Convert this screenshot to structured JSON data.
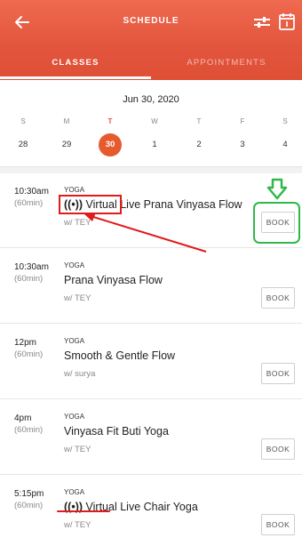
{
  "header": {
    "title": "SCHEDULE",
    "tabs": [
      {
        "label": "CLASSES",
        "active": true
      },
      {
        "label": "APPOINTMENTS",
        "active": false
      }
    ],
    "icons": {
      "back": "arrow-left-icon",
      "filter": "filter-sliders-icon",
      "calendar": "calendar-icon"
    }
  },
  "calendar": {
    "heading": "Jun 30, 2020",
    "days": [
      {
        "dow": "S",
        "dom": "28"
      },
      {
        "dow": "M",
        "dom": "29"
      },
      {
        "dow": "T",
        "dom": "30",
        "selected": true
      },
      {
        "dow": "W",
        "dom": "1"
      },
      {
        "dow": "T",
        "dom": "2"
      },
      {
        "dow": "F",
        "dom": "3"
      },
      {
        "dow": "S",
        "dom": "4"
      }
    ]
  },
  "classes": [
    {
      "time": "10:30am",
      "duration": "(60min)",
      "category": "YOGA",
      "virtual_mark": "((•))",
      "virtual_label": "Virtual",
      "name": "Live Prana Vinyasa Flow",
      "instructor": "w/ TEY",
      "book": "BOOK"
    },
    {
      "time": "10:30am",
      "duration": "(60min)",
      "category": "YOGA",
      "virtual_mark": "",
      "virtual_label": "",
      "name": "Prana Vinyasa Flow",
      "instructor": "w/ TEY",
      "book": "BOOK"
    },
    {
      "time": "12pm",
      "duration": "(60min)",
      "category": "YOGA",
      "virtual_mark": "",
      "virtual_label": "",
      "name": "Smooth & Gentle Flow",
      "instructor": "w/ surya",
      "book": "BOOK"
    },
    {
      "time": "4pm",
      "duration": "(60min)",
      "category": "YOGA",
      "virtual_mark": "",
      "virtual_label": "",
      "name": "Vinyasa Fit Buti Yoga",
      "instructor": "w/ TEY",
      "book": "BOOK"
    },
    {
      "time": "5:15pm",
      "duration": "(60min)",
      "category": "YOGA",
      "virtual_mark": "((•))",
      "virtual_label": "Virtual",
      "name": "Live Chair Yoga",
      "instructor": "w/ TEY",
      "book": "BOOK"
    }
  ],
  "annotations": {
    "highlight_color": "#e01b1b",
    "book_highlight_color": "#2fb84a"
  },
  "colors": {
    "brand": "#e2553c",
    "selected_day": "#e65a2e"
  }
}
